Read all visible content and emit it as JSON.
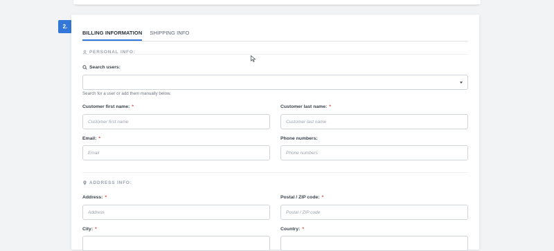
{
  "step": {
    "number": "2."
  },
  "tabs": [
    {
      "label": "BILLING INFORMATION",
      "active": true
    },
    {
      "label": "SHIPPING INFO",
      "active": false
    }
  ],
  "personal": {
    "heading": "PERSONAL INFO:",
    "icon": "user-icon",
    "search": {
      "label": "Search users:",
      "icon": "search-icon",
      "value": "",
      "help": "Search for a user or add them manually below."
    },
    "first_name": {
      "label": "Customer first name:",
      "required": "*",
      "placeholder": "Customer first name"
    },
    "last_name": {
      "label": "Customer last name:",
      "required": "*",
      "placeholder": "Customer last name"
    },
    "email": {
      "label": "Email:",
      "required": "*",
      "placeholder": "Email"
    },
    "phone": {
      "label": "Phone numbers:",
      "placeholder": "Phone numbers"
    }
  },
  "address": {
    "heading": "ADDRESS INFO:",
    "icon": "map-pin-icon",
    "address": {
      "label": "Address:",
      "required": "*",
      "placeholder": "Address"
    },
    "postal": {
      "label": "Postal / ZIP code:",
      "required": "*",
      "placeholder": "Postal / ZIP code"
    },
    "city": {
      "label": "City:",
      "required": "*"
    },
    "country": {
      "label": "Country:",
      "required": "*"
    }
  },
  "colors": {
    "accent": "#3378d8",
    "required": "#d9443b",
    "border": "#cfd4da"
  }
}
